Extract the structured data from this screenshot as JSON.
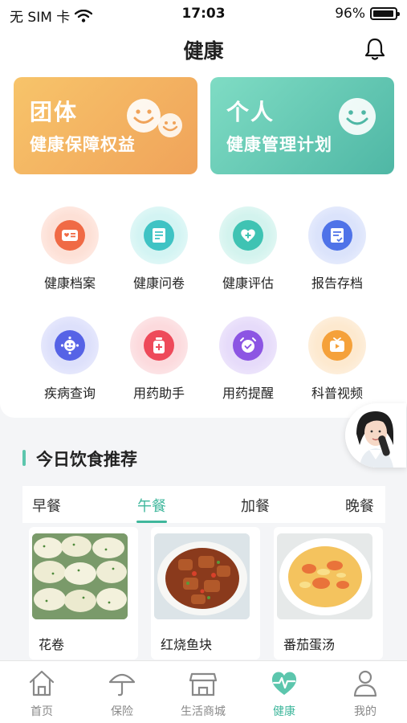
{
  "status_bar": {
    "carrier": "无 SIM 卡",
    "time": "17:03",
    "battery": "96%",
    "battery_level": 0.96
  },
  "header": {
    "title": "健康"
  },
  "cards": {
    "group": {
      "title": "团体",
      "subtitle": "健康保障权益"
    },
    "personal": {
      "title": "个人",
      "subtitle": "健康管理计划"
    }
  },
  "grid": {
    "items": [
      {
        "label": "健康档案",
        "icon": "health-record-icon",
        "color": "#f06a45"
      },
      {
        "label": "健康问卷",
        "icon": "questionnaire-icon",
        "color": "#3fc3c4"
      },
      {
        "label": "健康评估",
        "icon": "heart-plus-icon",
        "color": "#3fc3b3"
      },
      {
        "label": "报告存档",
        "icon": "report-icon",
        "color": "#4f73e8"
      },
      {
        "label": "疾病查询",
        "icon": "virus-icon",
        "color": "#5663e6"
      },
      {
        "label": "用药助手",
        "icon": "medicine-bottle-icon",
        "color": "#ee4a5a"
      },
      {
        "label": "用药提醒",
        "icon": "alarm-clock-icon",
        "color": "#8c55e3"
      },
      {
        "label": "科普视频",
        "icon": "tv-icon",
        "color": "#f5a13a"
      }
    ]
  },
  "diet": {
    "title": "今日饮食推荐",
    "tabs": [
      {
        "label": "早餐"
      },
      {
        "label": "午餐"
      },
      {
        "label": "加餐"
      },
      {
        "label": "晚餐"
      }
    ],
    "active_tab": "午餐",
    "foods": [
      {
        "name": "花卷"
      },
      {
        "name": "红烧鱼块"
      },
      {
        "name": "番茄蛋汤"
      }
    ]
  },
  "tabbar": {
    "items": [
      {
        "label": "首页",
        "icon": "home-icon"
      },
      {
        "label": "保险",
        "icon": "umbrella-icon"
      },
      {
        "label": "生活商城",
        "icon": "store-icon"
      },
      {
        "label": "健康",
        "icon": "heart-pulse-icon"
      },
      {
        "label": "我的",
        "icon": "user-icon"
      }
    ],
    "active": "健康"
  },
  "colors": {
    "accent": "#3fb79c",
    "group_card": "#f0a35a",
    "personal_card": "#4fb7a5"
  }
}
